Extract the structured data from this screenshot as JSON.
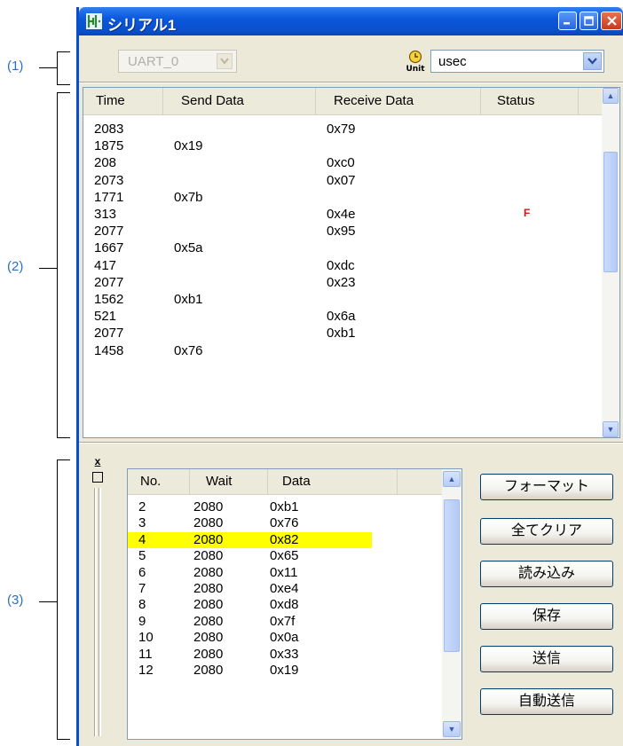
{
  "callouts": {
    "c1": "(1)",
    "c2": "(2)",
    "c3": "(3)"
  },
  "window": {
    "title": "シリアル1"
  },
  "toolbar": {
    "uart_value": "UART_0",
    "unit_value": "usec",
    "unit_icon": "clock-unit-icon"
  },
  "log": {
    "headers": [
      "Time",
      "Send Data",
      "Receive Data",
      "Status"
    ],
    "rows": [
      {
        "time": "2083",
        "send": "",
        "recv": "0x79",
        "status": ""
      },
      {
        "time": "1875",
        "send": "0x19",
        "recv": "",
        "status": ""
      },
      {
        "time": "208",
        "send": "",
        "recv": "0xc0",
        "status": ""
      },
      {
        "time": "2073",
        "send": "",
        "recv": "0x07",
        "status": ""
      },
      {
        "time": "1771",
        "send": "0x7b",
        "recv": "",
        "status": ""
      },
      {
        "time": "313",
        "send": "",
        "recv": "0x4e",
        "status": "F"
      },
      {
        "time": "2077",
        "send": "",
        "recv": "0x95",
        "status": ""
      },
      {
        "time": "1667",
        "send": "0x5a",
        "recv": "",
        "status": ""
      },
      {
        "time": "417",
        "send": "",
        "recv": "0xdc",
        "status": ""
      },
      {
        "time": "2077",
        "send": "",
        "recv": "0x23",
        "status": ""
      },
      {
        "time": "1562",
        "send": "0xb1",
        "recv": "",
        "status": ""
      },
      {
        "time": "521",
        "send": "",
        "recv": "0x6a",
        "status": ""
      },
      {
        "time": "2077",
        "send": "",
        "recv": "0xb1",
        "status": ""
      },
      {
        "time": "1458",
        "send": "0x76",
        "recv": "",
        "status": ""
      }
    ]
  },
  "send_list": {
    "headers": [
      "No.",
      "Wait",
      "Data"
    ],
    "rows": [
      {
        "no": "2",
        "wait": "2080",
        "data": "0xb1"
      },
      {
        "no": "3",
        "wait": "2080",
        "data": "0x76"
      },
      {
        "no": "4",
        "wait": "2080",
        "data": "0x82"
      },
      {
        "no": "5",
        "wait": "2080",
        "data": "0x65"
      },
      {
        "no": "6",
        "wait": "2080",
        "data": "0x11"
      },
      {
        "no": "7",
        "wait": "2080",
        "data": "0xe4"
      },
      {
        "no": "8",
        "wait": "2080",
        "data": "0xd8"
      },
      {
        "no": "9",
        "wait": "2080",
        "data": "0x7f"
      },
      {
        "no": "10",
        "wait": "2080",
        "data": "0x0a"
      },
      {
        "no": "11",
        "wait": "2080",
        "data": "0x33"
      },
      {
        "no": "12",
        "wait": "2080",
        "data": "0x19"
      }
    ],
    "selected_no": "4",
    "highlight_color": "#ffff00"
  },
  "buttons": {
    "format": "フォーマット",
    "clear_all": "全てクリア",
    "load": "読み込み",
    "save": "保存",
    "send": "送信",
    "auto_send": "自動送信"
  }
}
